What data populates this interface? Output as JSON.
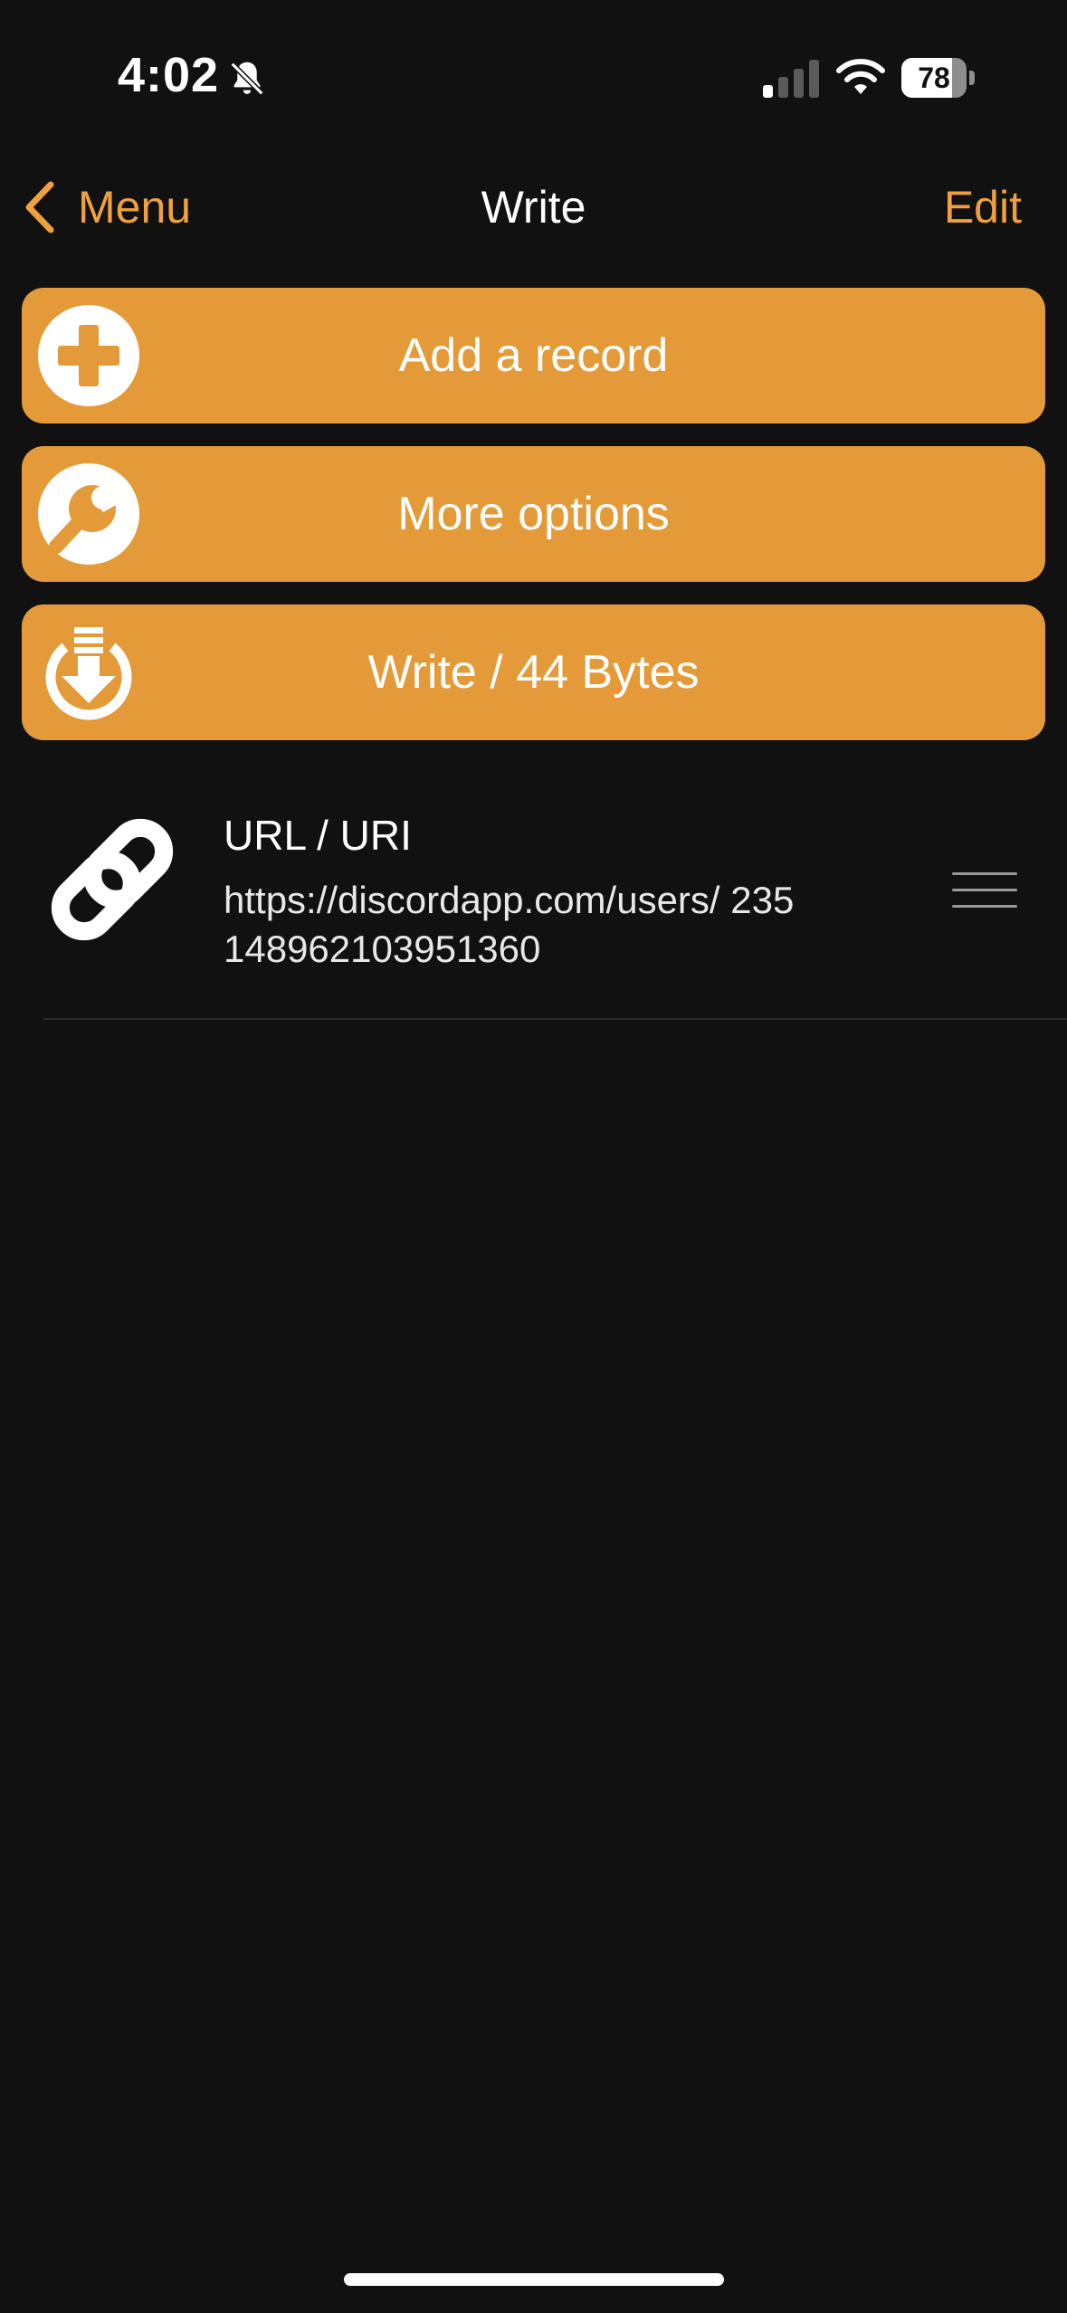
{
  "status_bar": {
    "time": "4:02",
    "battery_percent": "78",
    "battery_level": 0.78,
    "icons": [
      "bell-slash-icon",
      "cellular-signal-icon",
      "wifi-icon",
      "battery-icon"
    ]
  },
  "nav": {
    "back_label": "Menu",
    "title": "Write",
    "edit_label": "Edit",
    "back_icon": "chevron-left-icon"
  },
  "actions": {
    "add_record": {
      "label": "Add a record",
      "icon": "plus-circle-icon"
    },
    "more_options": {
      "label": "More options",
      "icon": "wrench-icon"
    },
    "write": {
      "label": "Write / 44 Bytes",
      "icon": "download-circle-icon"
    }
  },
  "records": [
    {
      "type": "URL / URI",
      "value": "https://discordapp.com/users/ 235148962103951360",
      "icon": "link-icon"
    }
  ],
  "colors": {
    "background": "#111111",
    "accent": "#f0a03c",
    "button": "#e49a38",
    "text": "#ffffff"
  }
}
